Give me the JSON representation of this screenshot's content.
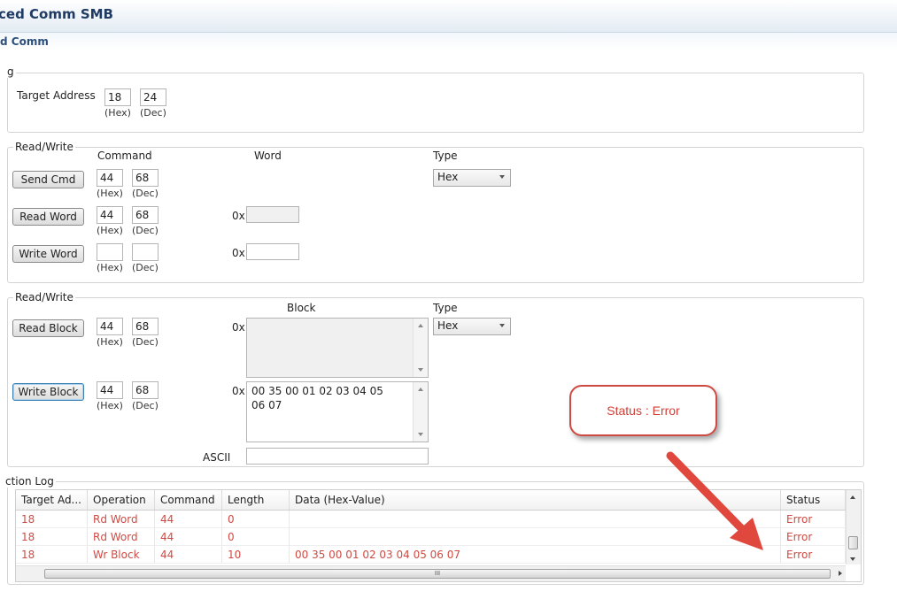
{
  "window": {
    "title": "ced Comm SMB",
    "subtitle": "d Comm"
  },
  "target_group": {
    "legend": "g",
    "label": "Target Address",
    "hex_value": "18",
    "dec_value": "24",
    "hex_unit": "(Hex)",
    "dec_unit": "(Dec)"
  },
  "word_group": {
    "legend": "Read/Write",
    "col_command": "Command",
    "col_word": "Word",
    "col_type": "Type",
    "type_value": "Hex",
    "prefix": "0x",
    "hex_unit": "(Hex)",
    "dec_unit": "(Dec)",
    "rows": [
      {
        "button": "Send Cmd",
        "hex": "44",
        "dec": "68",
        "word": ""
      },
      {
        "button": "Read Word",
        "hex": "44",
        "dec": "68",
        "word": ""
      },
      {
        "button": "Write Word",
        "hex": "",
        "dec": "",
        "word": ""
      }
    ]
  },
  "block_group": {
    "legend": "Read/Write",
    "col_block": "Block",
    "col_type": "Type",
    "type_value": "Hex",
    "prefix": "0x",
    "ascii_label": "ASCII",
    "ascii_value": "",
    "hex_unit": "(Hex)",
    "dec_unit": "(Dec)",
    "read": {
      "button": "Read Block",
      "hex": "44",
      "dec": "68",
      "block": ""
    },
    "write": {
      "button": "Write Block",
      "hex": "44",
      "dec": "68",
      "block_line1": "00 35 00 01 02 03 04 05",
      "block_line2": "06 07"
    }
  },
  "log": {
    "legend": "ction Log",
    "columns": [
      "Target Ad...",
      "Operation",
      "Command",
      "Length",
      "Data (Hex-Value)",
      "Status"
    ],
    "rows": [
      {
        "target": "18",
        "operation": "Rd Word",
        "command": "44",
        "length": "0",
        "data": "",
        "status": "Error"
      },
      {
        "target": "18",
        "operation": "Rd Word",
        "command": "44",
        "length": "0",
        "data": "",
        "status": "Error"
      },
      {
        "target": "18",
        "operation": "Wr Block",
        "command": "44",
        "length": "10",
        "data": "00 35 00 01 02 03 04 05 06 07",
        "status": "Error"
      }
    ],
    "hscroll_grip": "III"
  },
  "callout": {
    "text": "Status : Error"
  },
  "colors": {
    "error_text": "#d04a43",
    "callout_border": "#cf4a42",
    "arrow": "#e0483e",
    "title": "#1f3b63"
  }
}
